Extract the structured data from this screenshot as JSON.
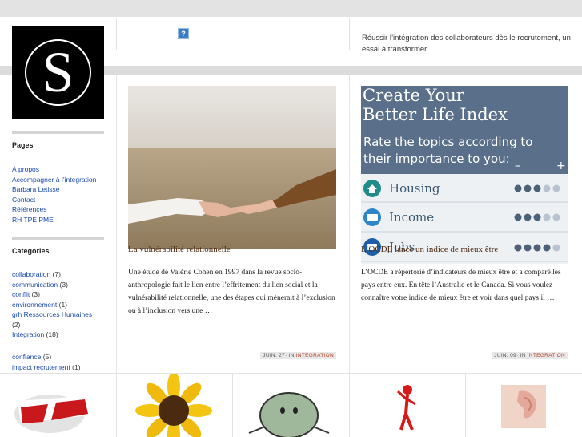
{
  "header": {
    "help_icon": "?",
    "tagline": "Réussir l’intégration des collaborateurs dès le recrutement, un essai à transformer"
  },
  "logo": {
    "letter": "S"
  },
  "sidebar": {
    "pages_title": "Pages",
    "pages": [
      "À propos",
      "Accompagner à l’integration",
      "Barbara Letisse",
      "Contact",
      "Références",
      "RH TPE PME"
    ],
    "categories_title": "Categories",
    "categories": [
      {
        "name": "collaboration",
        "count": "(7)"
      },
      {
        "name": "communication",
        "count": "(3)"
      },
      {
        "name": "conflit",
        "count": "(3)"
      },
      {
        "name": "environnement",
        "count": "(1)"
      },
      {
        "name": "grh Ressources Humaines",
        "count": "(2)"
      },
      {
        "name": "Integration",
        "count": "(18)"
      }
    ],
    "categories2": [
      {
        "name": "confiance",
        "count": "(5)"
      },
      {
        "name": "impact recrutement",
        "count": "(1)"
      }
    ]
  },
  "posts": [
    {
      "title": "La vulnérabilité relationnelle",
      "excerpt": "Une étude de Valérie Cohen en 1997 dans la revue socio-anthropologie  fait le lien entre l’effritement du lien social et la vulnérabilité relationnelle, une des étapes qui mènerait à l’exclusion ou à l’inclusion vers une …",
      "date": "JUIN. 27",
      "in": "· IN ",
      "category": "INTEGRATION"
    },
    {
      "title": "L’OCDE lance un indice de mieux être",
      "excerpt": "L’OCDE a répertorié d’indicateurs de mieux être et a comparé les pays entre eux. En tête l’Australie et le Canada. Si vous voulez  connaître votre indice de mieux être et voir dans quel pays il …",
      "date": "JUIN. 09",
      "in": "· IN ",
      "category": "INTEGRATION",
      "image_text": {
        "line1": "Create Your",
        "line2": "Better Life Index",
        "line3": "Rate the topics according to",
        "line4": "their importance to you:",
        "minus": "–",
        "plus": "+",
        "rows": [
          "Housing",
          "Income",
          "Jobs"
        ]
      }
    }
  ],
  "colors": {
    "link": "#1a4aa8",
    "post_title": "#4e2a12",
    "category": "#b2462a"
  }
}
